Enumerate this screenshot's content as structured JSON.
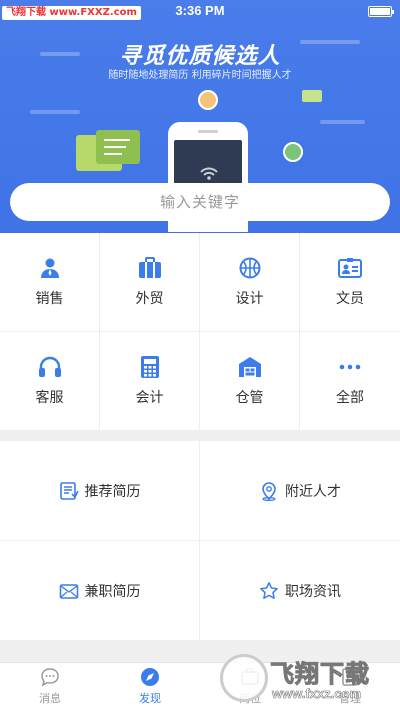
{
  "status": {
    "time": "3:36 PM",
    "watermark": "飞翔下载 www.FXXZ.com"
  },
  "banner": {
    "title": "寻觅优质候选人",
    "subtitle": "随时随地处理简历 利用碎片时间把握人才"
  },
  "search": {
    "placeholder": "输入关键字"
  },
  "categories": [
    {
      "label": "销售",
      "icon": "person-icon"
    },
    {
      "label": "外贸",
      "icon": "briefcase-icon"
    },
    {
      "label": "设计",
      "icon": "basketball-icon"
    },
    {
      "label": "文员",
      "icon": "id-card-icon"
    },
    {
      "label": "客服",
      "icon": "headset-icon"
    },
    {
      "label": "会计",
      "icon": "calculator-icon"
    },
    {
      "label": "仓管",
      "icon": "warehouse-icon"
    },
    {
      "label": "全部",
      "icon": "more-icon"
    }
  ],
  "features": [
    {
      "label": "推荐简历",
      "icon": "resume-icon"
    },
    {
      "label": "附近人才",
      "icon": "location-icon"
    },
    {
      "label": "兼职简历",
      "icon": "mail-icon"
    },
    {
      "label": "职场资讯",
      "icon": "star-icon"
    }
  ],
  "tabs": [
    {
      "label": "消息",
      "icon": "chat-icon",
      "active": false
    },
    {
      "label": "发现",
      "icon": "compass-icon",
      "active": true
    },
    {
      "label": "岗位",
      "icon": "job-icon",
      "active": false
    },
    {
      "label": "管理",
      "icon": "manage-icon",
      "active": false
    }
  ],
  "watermark_bottom": {
    "text": "飞翔下载",
    "url": "www.fxxz.com"
  },
  "colors": {
    "accent": "#3b7ded",
    "banner": "#4a7dea"
  }
}
